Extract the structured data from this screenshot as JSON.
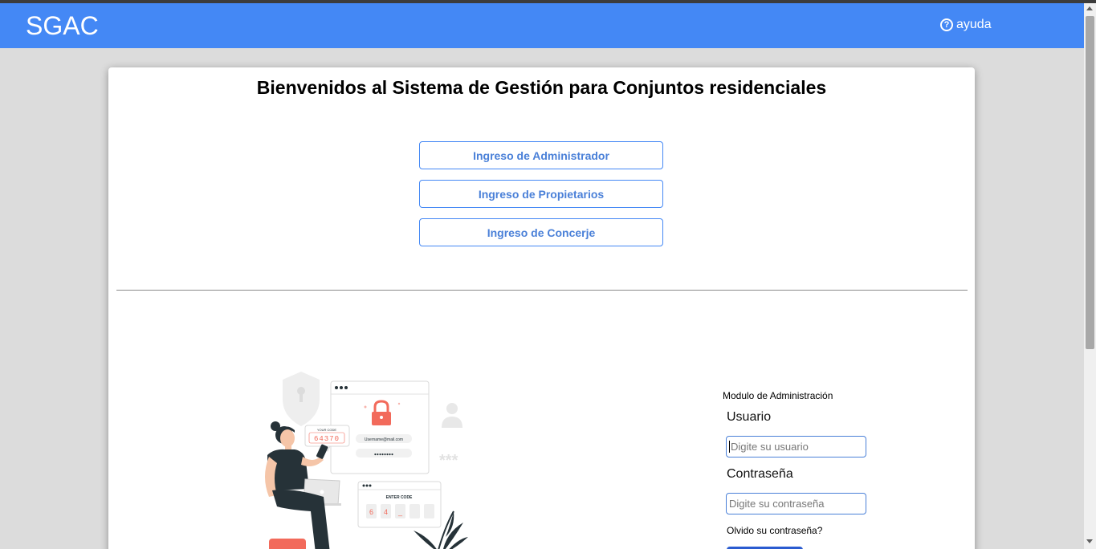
{
  "header": {
    "brand": "SGAC",
    "help_label": "ayuda",
    "help_icon": "question-circle-icon"
  },
  "main": {
    "title": "Bienvenidos al Sistema de Gestión para Conjuntos residenciales",
    "roles": [
      {
        "label": "Ingreso de Administrador"
      },
      {
        "label": "Ingreso de Propietarios"
      },
      {
        "label": "Ingreso de Concerje"
      }
    ]
  },
  "illustration": {
    "code_label": "YOUR CODE",
    "code_value": "64370",
    "email_text": "Username@mail.com",
    "password_mask": "●●●●●●●●",
    "enter_code_label": "ENTER CODE",
    "enter_digits": [
      "6",
      "4",
      "_",
      "",
      ""
    ],
    "stars": "***"
  },
  "login": {
    "module_title": "Modulo de Administración",
    "user_label": "Usuario",
    "user_placeholder": "Digite su usuario",
    "password_label": "Contraseña",
    "password_placeholder": "Digite su contraseña",
    "forgot_label": "Olvido su contraseña?"
  },
  "colors": {
    "navbar": "#4488f5",
    "accent": "#4a80d8",
    "background": "#dcdcdc",
    "illus_red": "#f26a5b",
    "illus_dark": "#263238"
  }
}
